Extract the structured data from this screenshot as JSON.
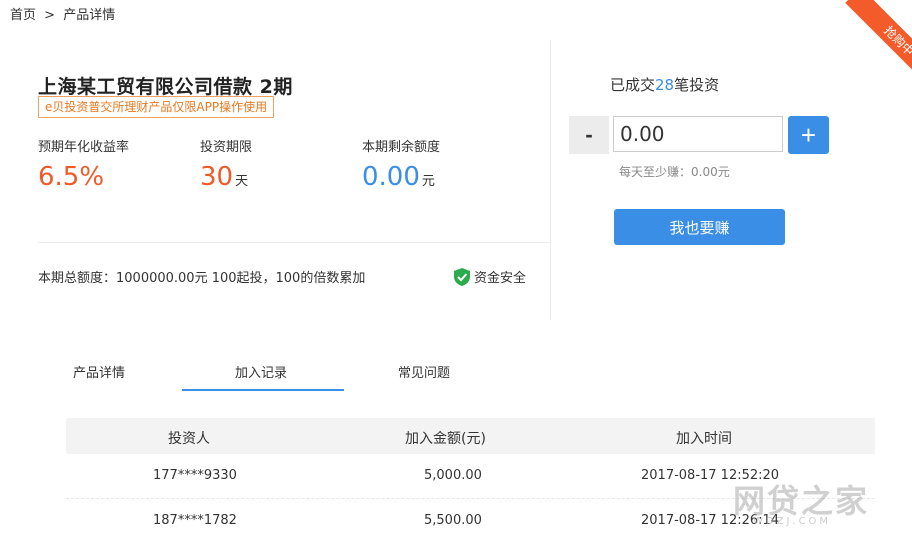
{
  "breadcrumb": {
    "home": "首页",
    "sep": ">",
    "current": "产品详情"
  },
  "product": {
    "title": "上海某工贸有限公司借款 2期",
    "notice": "e贝投资普交所理财产品仅限APP操作使用",
    "stats": [
      {
        "label": "预期年化收益率",
        "value": "6.5%",
        "unit": ""
      },
      {
        "label": "投资期限",
        "value": "30",
        "unit": "天"
      },
      {
        "label": "本期剩余额度",
        "value": "0.00",
        "unit": "元"
      }
    ],
    "total": "本期总额度：1000000.00元 100起投，100的倍数累加",
    "safe_label": "资金安全"
  },
  "ribbon": "抢购中",
  "invest": {
    "deals_prefix": "已成交",
    "deals_count": "28",
    "deals_suffix": "笔投资",
    "minus": "-",
    "plus": "+",
    "amount_value": "0.00",
    "earn": "每天至少赚：0.00元",
    "button": "我也要赚"
  },
  "tabs": [
    {
      "label": "产品详情",
      "active": false
    },
    {
      "label": "加入记录",
      "active": true
    },
    {
      "label": "常见问题",
      "active": false
    }
  ],
  "table": {
    "headers": [
      "投资人",
      "加入金额(元)",
      "加入时间"
    ],
    "rows": [
      [
        "177****9330",
        "5,000.00",
        "2017-08-17 12:52:20"
      ],
      [
        "187****1782",
        "5,500.00",
        "2017-08-17 12:26:14"
      ]
    ]
  },
  "watermark": {
    "main": "网贷之家",
    "sub": "WDZJ.COM"
  },
  "colors": {
    "accent_blue": "#3a8ee6",
    "accent_orange": "#f05a28",
    "ribbon": "#f45b2a"
  }
}
